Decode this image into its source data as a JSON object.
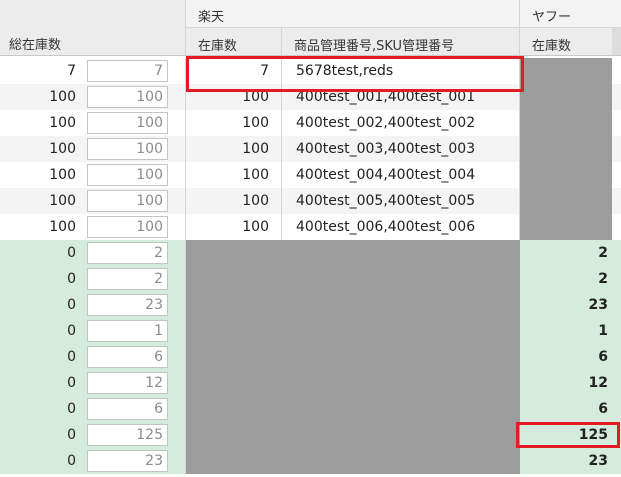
{
  "header": {
    "total_stock": "総在庫数",
    "rakuten": {
      "group": "楽天",
      "stock": "在庫数",
      "sku": "商品管理番号,SKU管理番号"
    },
    "yahoo": {
      "group": "ヤフー",
      "stock": "在庫数"
    }
  },
  "rows": [
    {
      "total": "7",
      "input": "7",
      "rakuten_stock": "7",
      "rakuten_sku": "5678test,reds",
      "yahoo_stock": ""
    },
    {
      "total": "100",
      "input": "100",
      "rakuten_stock": "100",
      "rakuten_sku": "400test_001,400test_001",
      "yahoo_stock": ""
    },
    {
      "total": "100",
      "input": "100",
      "rakuten_stock": "100",
      "rakuten_sku": "400test_002,400test_002",
      "yahoo_stock": ""
    },
    {
      "total": "100",
      "input": "100",
      "rakuten_stock": "100",
      "rakuten_sku": "400test_003,400test_003",
      "yahoo_stock": ""
    },
    {
      "total": "100",
      "input": "100",
      "rakuten_stock": "100",
      "rakuten_sku": "400test_004,400test_004",
      "yahoo_stock": ""
    },
    {
      "total": "100",
      "input": "100",
      "rakuten_stock": "100",
      "rakuten_sku": "400test_005,400test_005",
      "yahoo_stock": ""
    },
    {
      "total": "100",
      "input": "100",
      "rakuten_stock": "100",
      "rakuten_sku": "400test_006,400test_006",
      "yahoo_stock": ""
    },
    {
      "total": "0",
      "input": "2",
      "rakuten_stock": "",
      "rakuten_sku": "",
      "yahoo_stock": "2"
    },
    {
      "total": "0",
      "input": "2",
      "rakuten_stock": "",
      "rakuten_sku": "",
      "yahoo_stock": "2"
    },
    {
      "total": "0",
      "input": "23",
      "rakuten_stock": "",
      "rakuten_sku": "",
      "yahoo_stock": "23"
    },
    {
      "total": "0",
      "input": "1",
      "rakuten_stock": "",
      "rakuten_sku": "",
      "yahoo_stock": "1"
    },
    {
      "total": "0",
      "input": "6",
      "rakuten_stock": "",
      "rakuten_sku": "",
      "yahoo_stock": "6"
    },
    {
      "total": "0",
      "input": "12",
      "rakuten_stock": "",
      "rakuten_sku": "",
      "yahoo_stock": "12"
    },
    {
      "total": "0",
      "input": "6",
      "rakuten_stock": "",
      "rakuten_sku": "",
      "yahoo_stock": "6"
    },
    {
      "total": "0",
      "input": "125",
      "rakuten_stock": "",
      "rakuten_sku": "",
      "yahoo_stock": "125"
    },
    {
      "total": "0",
      "input": "23",
      "rakuten_stock": "",
      "rakuten_sku": "",
      "yahoo_stock": "23"
    }
  ],
  "colors": {
    "highlight": "#e41b23",
    "green_row": "#d5ecdc",
    "inactive_cell": "#9c9c9c"
  }
}
